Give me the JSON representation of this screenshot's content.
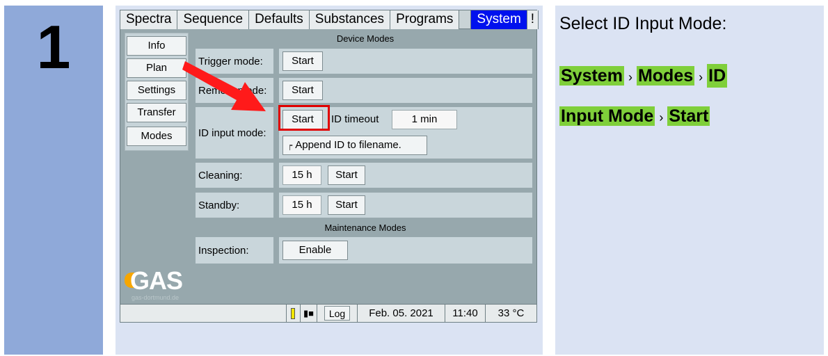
{
  "step_number": "1",
  "tabs": [
    "Spectra",
    "Sequence",
    "Defaults",
    "Substances",
    "Programs",
    "System",
    "!"
  ],
  "side_menu": [
    "Info",
    "Plan",
    "Settings",
    "Transfer",
    "Modes"
  ],
  "sections": {
    "device_modes": "Device Modes",
    "maintenance_modes": "Maintenance Modes"
  },
  "rows": {
    "trigger_label": "Trigger mode:",
    "trigger_button": "Start",
    "remote_label": "Remote mode:",
    "remote_button": "Start",
    "id_label": "ID input mode:",
    "id_button": "Start",
    "id_timeout_label": "ID timeout",
    "id_timeout_value": "1 min",
    "append_id_label": "Append ID to filename.",
    "cleaning_label": "Cleaning:",
    "cleaning_value": "15 h",
    "cleaning_button": "Start",
    "standby_label": "Standby:",
    "standby_value": "15 h",
    "standby_button": "Start",
    "inspection_label": "Inspection:",
    "inspection_button": "Enable"
  },
  "logo": {
    "text": "GAS",
    "subtext": "gas-dortmund.de"
  },
  "status_bar": {
    "log": "Log",
    "date": "Feb. 05. 2021",
    "time": "11:40",
    "temp": "33 °C"
  },
  "instructions": {
    "title": "Select ID Input Mode:",
    "path": [
      "System",
      "Modes",
      "ID Input Mode",
      "Start"
    ],
    "separator": "›"
  },
  "colors": {
    "accent": "#0011ee",
    "highlight_box": "#e00000",
    "arrow": "#ff1a1a",
    "path_highlight": "#7fcf3a",
    "step_column": "#8fa9d9"
  }
}
